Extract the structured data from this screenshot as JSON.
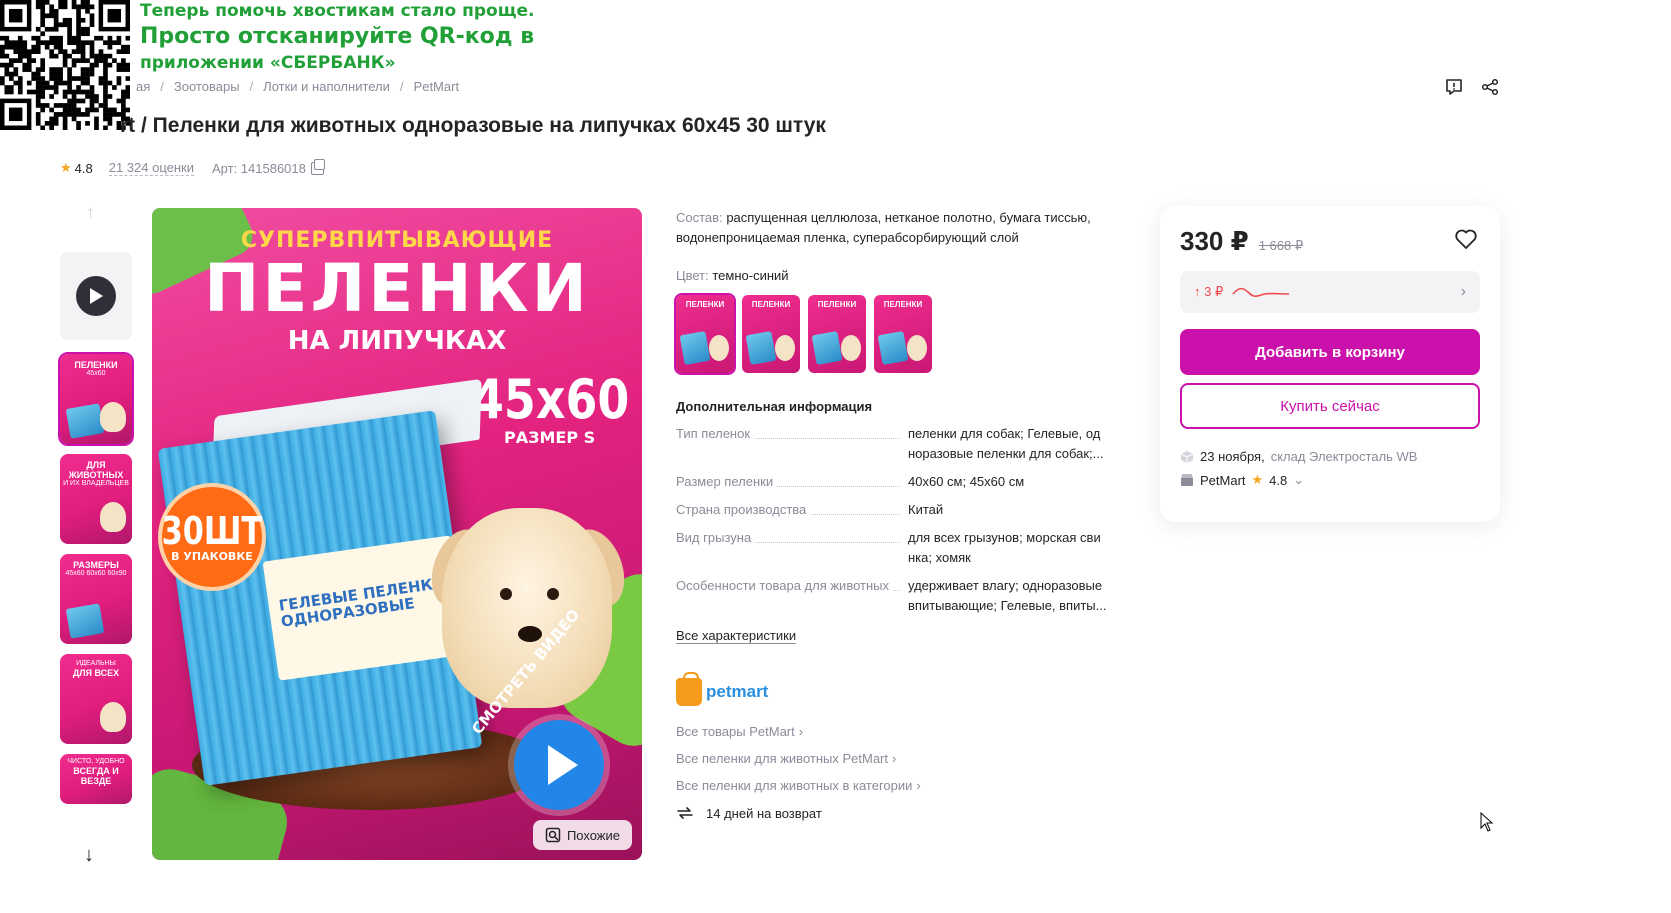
{
  "promo": {
    "line1": "Теперь помочь хвостикам стало проще.",
    "line2": "Просто отсканируйте QR-код в",
    "line3": "приложении «СБЕРБАНК»"
  },
  "breadcrumb": [
    "ая",
    "Зоотовары",
    "Лотки и наполнители",
    "PetMart"
  ],
  "product": {
    "title": "rt / Пеленки для животных одноразовые на липучках 60х45 30 штук",
    "rating": "4.8",
    "reviews": "21 324 оценки",
    "article": "Арт: 141586018"
  },
  "main_image": {
    "headline_top": "СУПЕРВПИТЫВАЮЩИЕ",
    "headline_big": "ПЕЛЕНКИ",
    "headline_sub": "НА ЛИПУЧКАХ",
    "size": "45x60",
    "size_label": "РАЗМЕР S",
    "badge_count": "30ШТ",
    "badge_label": "В УПАКОВКЕ",
    "pack_label": "ГЕЛЕВЫЕ ПЕЛЕНКИ ОДНОРАЗОВЫЕ",
    "video_label": "СМОТРЕТЬ ВИДЕО",
    "similar_label": "Похожие"
  },
  "thumbnails": [
    {
      "t": "ПЕЛЕНКИ",
      "s": "45x60"
    },
    {
      "t": "ДЛЯ ЖИВОТНЫХ",
      "s": "И ИХ ВЛАДЕЛЬЦЕВ"
    },
    {
      "t": "РАЗМЕРЫ",
      "s": "45x60 60x60 60x90"
    },
    {
      "t": "ДЛЯ ВСЕХ",
      "s": "ИДЕАЛЬНЫ"
    },
    {
      "t": "ВСЕГДА И ВЕЗДЕ",
      "s": "ЧИСТО, УДОБНО"
    }
  ],
  "info": {
    "composition_label": "Состав:",
    "composition_value": "распущенная целлюлоза, нетканое полотно, бумага тиссью, водонепроницаемая пленка, суперабсорбирующий слой",
    "color_label": "Цвет:",
    "color_value": "темно-синий",
    "swatch_text": "ПЕЛЕНКИ",
    "additional_heading": "Дополнительная информация",
    "specs": [
      {
        "k": "Тип пеленок",
        "v": "пеленки для собак; Гелевые, од норазовые пеленки для собак;..."
      },
      {
        "k": "Размер пеленки",
        "v": "40x60 см; 45x60 см"
      },
      {
        "k": "Страна производства",
        "v": "Китай"
      },
      {
        "k": "Вид грызуна",
        "v": "для всех грызунов; морская сви нка; хомяк"
      },
      {
        "k": "Особенности товара для животных",
        "v": "удерживает влагу; одноразовые впитывающие; Гелевые, впиты..."
      }
    ],
    "all_specs": "Все характеристики",
    "brand_logo": "petmart",
    "brand_links": [
      "Все товары PetMart",
      "Все пеленки для животных PetMart",
      "Все пеленки для животных в категории"
    ],
    "return_text": "14 дней на возврат"
  },
  "buy": {
    "price": "330 ₽",
    "old_price": "1 668 ₽",
    "price_change": "↑ 3 ₽",
    "add_to_cart": "Добавить в корзину",
    "buy_now": "Купить сейчас",
    "delivery_date": "23 ноября,",
    "warehouse": "склад Электросталь WB",
    "seller": "PetMart",
    "seller_rating": "4.8"
  },
  "colors": {
    "accent": "#cb11ab",
    "promo_green": "#21a038",
    "star": "#f5a623"
  }
}
